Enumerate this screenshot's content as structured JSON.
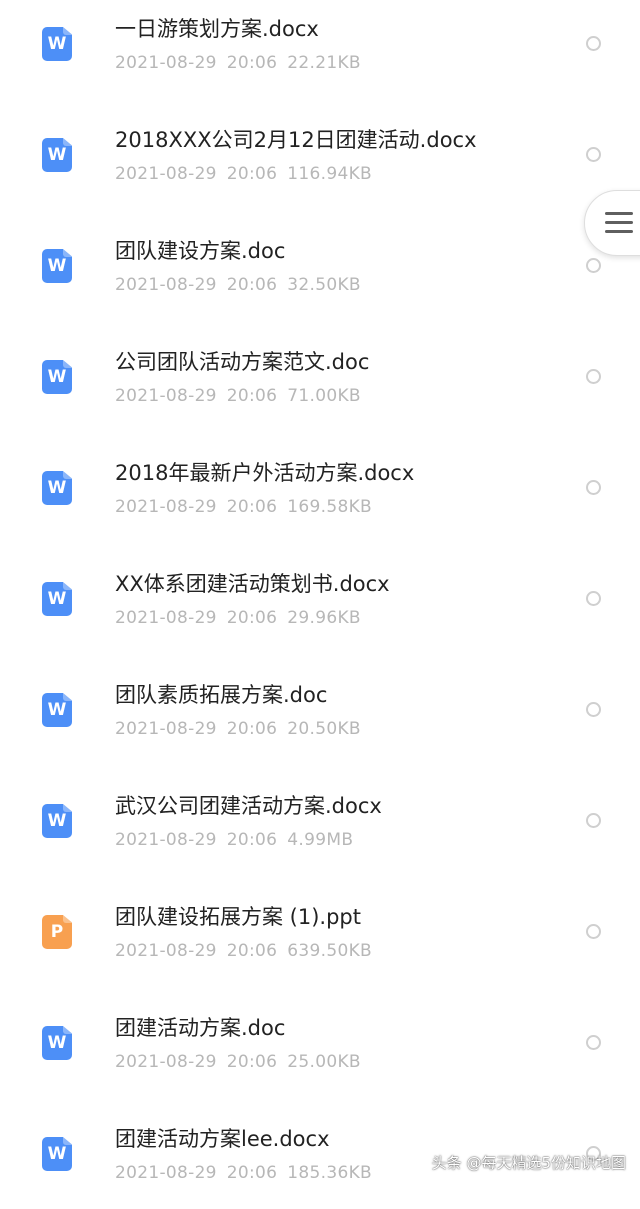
{
  "files": [
    {
      "name": "一日游策划方案.docx",
      "date": "2021-08-29",
      "time": "20:06",
      "size": "22.21KB",
      "type": "word",
      "icon_letter": "W"
    },
    {
      "name": "2018XXX公司2月12日团建活动.docx",
      "date": "2021-08-29",
      "time": "20:06",
      "size": "116.94KB",
      "type": "word",
      "icon_letter": "W"
    },
    {
      "name": "团队建设方案.doc",
      "date": "2021-08-29",
      "time": "20:06",
      "size": "32.50KB",
      "type": "word",
      "icon_letter": "W"
    },
    {
      "name": "公司团队活动方案范文.doc",
      "date": "2021-08-29",
      "time": "20:06",
      "size": "71.00KB",
      "type": "word",
      "icon_letter": "W"
    },
    {
      "name": "2018年最新户外活动方案.docx",
      "date": "2021-08-29",
      "time": "20:06",
      "size": "169.58KB",
      "type": "word",
      "icon_letter": "W"
    },
    {
      "name": "XX体系团建活动策划书.docx",
      "date": "2021-08-29",
      "time": "20:06",
      "size": "29.96KB",
      "type": "word",
      "icon_letter": "W"
    },
    {
      "name": "团队素质拓展方案.doc",
      "date": "2021-08-29",
      "time": "20:06",
      "size": "20.50KB",
      "type": "word",
      "icon_letter": "W"
    },
    {
      "name": "武汉公司团建活动方案.docx",
      "date": "2021-08-29",
      "time": "20:06",
      "size": "4.99MB",
      "type": "word",
      "icon_letter": "W"
    },
    {
      "name": "团队建设拓展方案 (1).ppt",
      "date": "2021-08-29",
      "time": "20:06",
      "size": "639.50KB",
      "type": "ppt",
      "icon_letter": "P"
    },
    {
      "name": "团建活动方案.doc",
      "date": "2021-08-29",
      "time": "20:06",
      "size": "25.00KB",
      "type": "word",
      "icon_letter": "W"
    },
    {
      "name": "团建活动方案lee.docx",
      "date": "2021-08-29",
      "time": "20:06",
      "size": "185.36KB",
      "type": "word",
      "icon_letter": "W"
    }
  ],
  "side_menu": {
    "icon": "hamburger-menu-icon"
  },
  "watermark": {
    "text": "头条 @每天精选5份知识地图"
  },
  "colors": {
    "word_icon": "#4d8ff7",
    "ppt_icon": "#f8a050",
    "name_text": "#222222",
    "meta_text": "#b7b7b7",
    "radio_border": "#cfcfcf"
  }
}
